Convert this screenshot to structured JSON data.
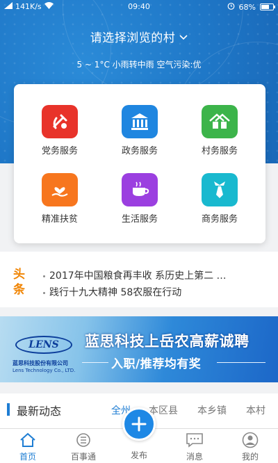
{
  "statusbar": {
    "speed": "141K/s",
    "time": "09:40",
    "battery": "68%"
  },
  "header": {
    "village_select": "请选择浏览的村",
    "weather": "5 ~ 1°C  小雨转中雨  空气污染:优"
  },
  "services": [
    {
      "label": "党务服务",
      "icon": "party-emblem-icon",
      "color": "#e8332a"
    },
    {
      "label": "政务服务",
      "icon": "government-building-icon",
      "color": "#1f86e0"
    },
    {
      "label": "村务服务",
      "icon": "village-houses-icon",
      "color": "#3cb44a"
    },
    {
      "label": "精准扶贫",
      "icon": "heart-hand-icon",
      "color": "#f7761e"
    },
    {
      "label": "生活服务",
      "icon": "coffee-cup-icon",
      "color": "#9b3fe0"
    },
    {
      "label": "商务服务",
      "icon": "necktie-icon",
      "color": "#19b9cf"
    }
  ],
  "headlines": {
    "badge": "头条",
    "items": [
      "2017年中国粮食再丰收 系历史上第二 …",
      "践行十九大精神 58农服在行动"
    ]
  },
  "banner": {
    "logo": "LENS",
    "company_cn": "蓝思科技股份有限公司",
    "company_en": "Lens Technology Co., LTD.",
    "title": "蓝思科技上岳农高薪诚聘",
    "subtitle": "入职/推荐均有奖"
  },
  "latest": {
    "title": "最新动态",
    "tabs": [
      "全州",
      "本区县",
      "本乡镇",
      "本村"
    ]
  },
  "bottom_nav": {
    "home": "首页",
    "baishitong": "百事通",
    "publish": "发布",
    "messages": "消息",
    "mine": "我的"
  },
  "colors": {
    "primary": "#1e7dd3",
    "headline_badge": "#f08300"
  }
}
